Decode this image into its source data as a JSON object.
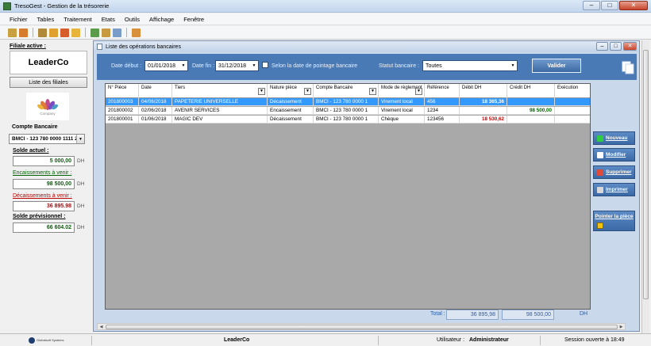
{
  "window": {
    "title": "TresoGest - Gestion de la trésorerie",
    "min_symbol": "–",
    "max_symbol": "□",
    "close_symbol": "✕"
  },
  "menu": [
    "Fichier",
    "Tables",
    "Traitement",
    "Etats",
    "Outils",
    "Affichage",
    "Fenêtre"
  ],
  "left": {
    "filiale_label": "Filiale active :",
    "filiale_name": "LeaderCo",
    "filiales_button": "Liste des filiales",
    "logo_text": "Company",
    "compte_label": "Compte Bancaire",
    "compte_value": "BMCI - 123 780 0000 1111 2",
    "solde_actuel_label": "Solde actuel :",
    "solde_actuel": "5 000,00",
    "encaissements_label": "Encaissements à venir :",
    "encaissements": "98 500,00",
    "decaissements_label": "Décaissements à venir :",
    "decaissements": "36 895.98",
    "previsionnel_label": "Solde prévisionnel :",
    "previsionnel": "66 604.02",
    "currency": "DH"
  },
  "child": {
    "title": "Liste des opérations bancaires",
    "filter": {
      "date_debut_label": "Date début :",
      "date_debut": "01/01/2018",
      "date_fin_label": "Date fin :",
      "date_fin": "31/12/2018",
      "pointage_label": "Selon la date de pointage bancaire",
      "statut_label": "Statut bancaire :",
      "statut_value": "Toutes",
      "valider": "Valider"
    },
    "columns": [
      {
        "label": "N° Pièce",
        "sort": false
      },
      {
        "label": "Date",
        "sort": false
      },
      {
        "label": "Tiers",
        "sort": true
      },
      {
        "label": "Nature pièce",
        "sort": true
      },
      {
        "label": "Compte Bancaire",
        "sort": true
      },
      {
        "label": "Mode de règlement",
        "sort": true
      },
      {
        "label": "Référence",
        "sort": false
      },
      {
        "label": "Débit DH",
        "sort": false
      },
      {
        "label": "Crédit DH",
        "sort": false
      },
      {
        "label": "Exécution",
        "sort": false
      }
    ],
    "rows": [
      {
        "piece": "201800003",
        "date": "04/06/2018",
        "tiers": "PAPETERIE UNIVERSELLE",
        "nature": "Décaissement",
        "compte": "BMCI - 123 780 0000 1",
        "mode": "Virement local",
        "ref": "456",
        "debit": "18 365,36",
        "credit": "",
        "exec": "",
        "selected": true
      },
      {
        "piece": "201800002",
        "date": "02/06/2018",
        "tiers": "AVENIR SERVICES",
        "nature": "Encaissement",
        "compte": "BMCI - 123 780 0000 1",
        "mode": "Virement local",
        "ref": "1234",
        "debit": "",
        "credit": "98 500,00",
        "exec": "",
        "selected": false
      },
      {
        "piece": "201800001",
        "date": "01/06/2018",
        "tiers": "MAGIC DEV",
        "nature": "Décaissement",
        "compte": "BMCI - 123 780 0000 1",
        "mode": "Chèque",
        "ref": "123456",
        "debit": "18 530,62",
        "credit": "",
        "exec": "",
        "selected": false
      }
    ],
    "totals": {
      "label": "Total :",
      "debit": "36 895,98",
      "credit": "98 500,00",
      "currency": "DH"
    },
    "actions": {
      "nouveau": "Nouveau",
      "modifier": "Modifier",
      "supprimer": "Supprimer",
      "imprimer": "Imprimer",
      "pointer": "Pointer la pièce"
    }
  },
  "status": {
    "company": "LeaderCo",
    "user_label": "Utilisateur :",
    "user": "Administrateur",
    "session": "Session ouverte à 18:49",
    "brand_text": "Globalsoft Systems"
  },
  "colors": {
    "selected_row": "#3399ff",
    "filter_bar": "#4a7ab5",
    "credit_green": "#006400",
    "debit_red": "#c00000"
  }
}
